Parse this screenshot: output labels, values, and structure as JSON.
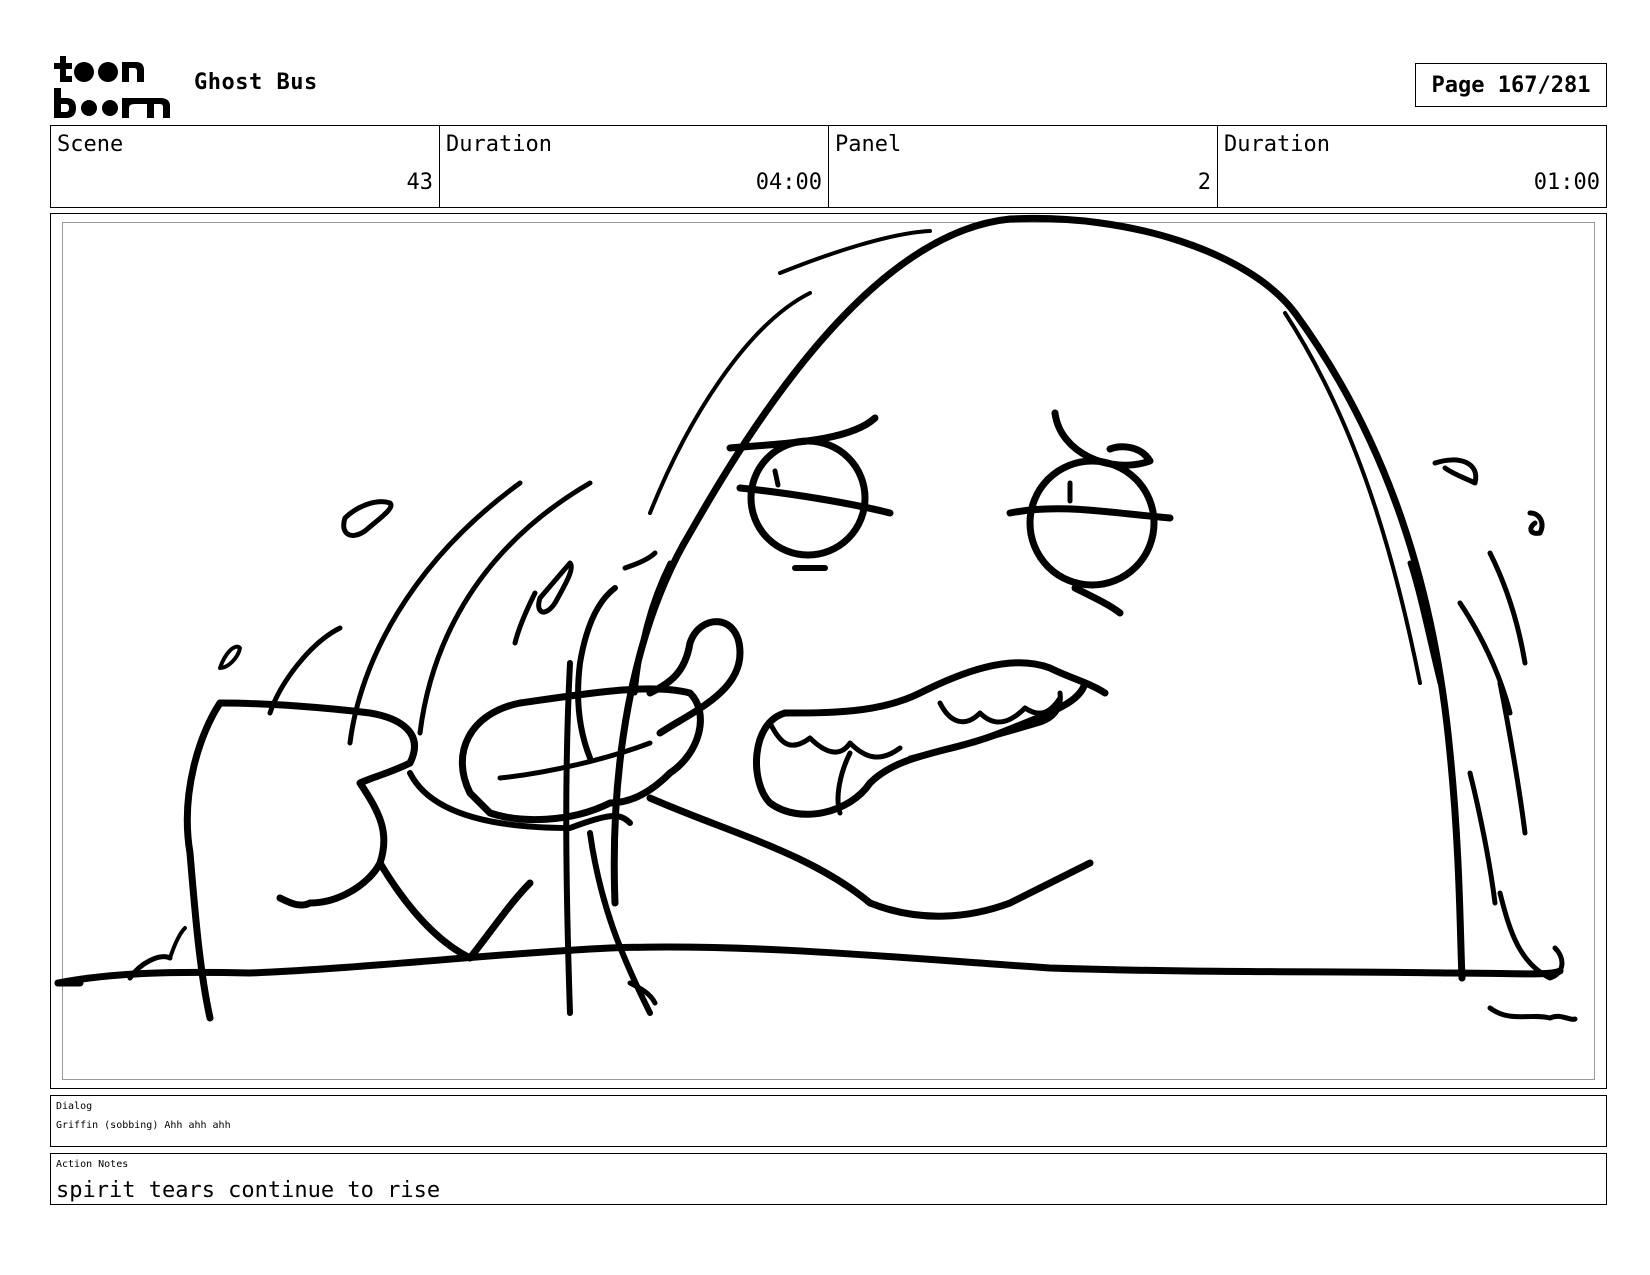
{
  "header": {
    "logo_text": "toon boom",
    "project_title": "Ghost Bus",
    "page_label": "Page 167/281"
  },
  "info": {
    "scene_label": "Scene",
    "scene_value": "43",
    "scene_duration_label": "Duration",
    "scene_duration_value": "04:00",
    "panel_label": "Panel",
    "panel_value": "2",
    "panel_duration_label": "Duration",
    "panel_duration_value": "01:00"
  },
  "dialog": {
    "label": "Dialog",
    "text": "Griffin (sobbing) Ahh ahh ahh"
  },
  "action_notes": {
    "label": "Action Notes",
    "text": "spirit tears continue to rise"
  }
}
